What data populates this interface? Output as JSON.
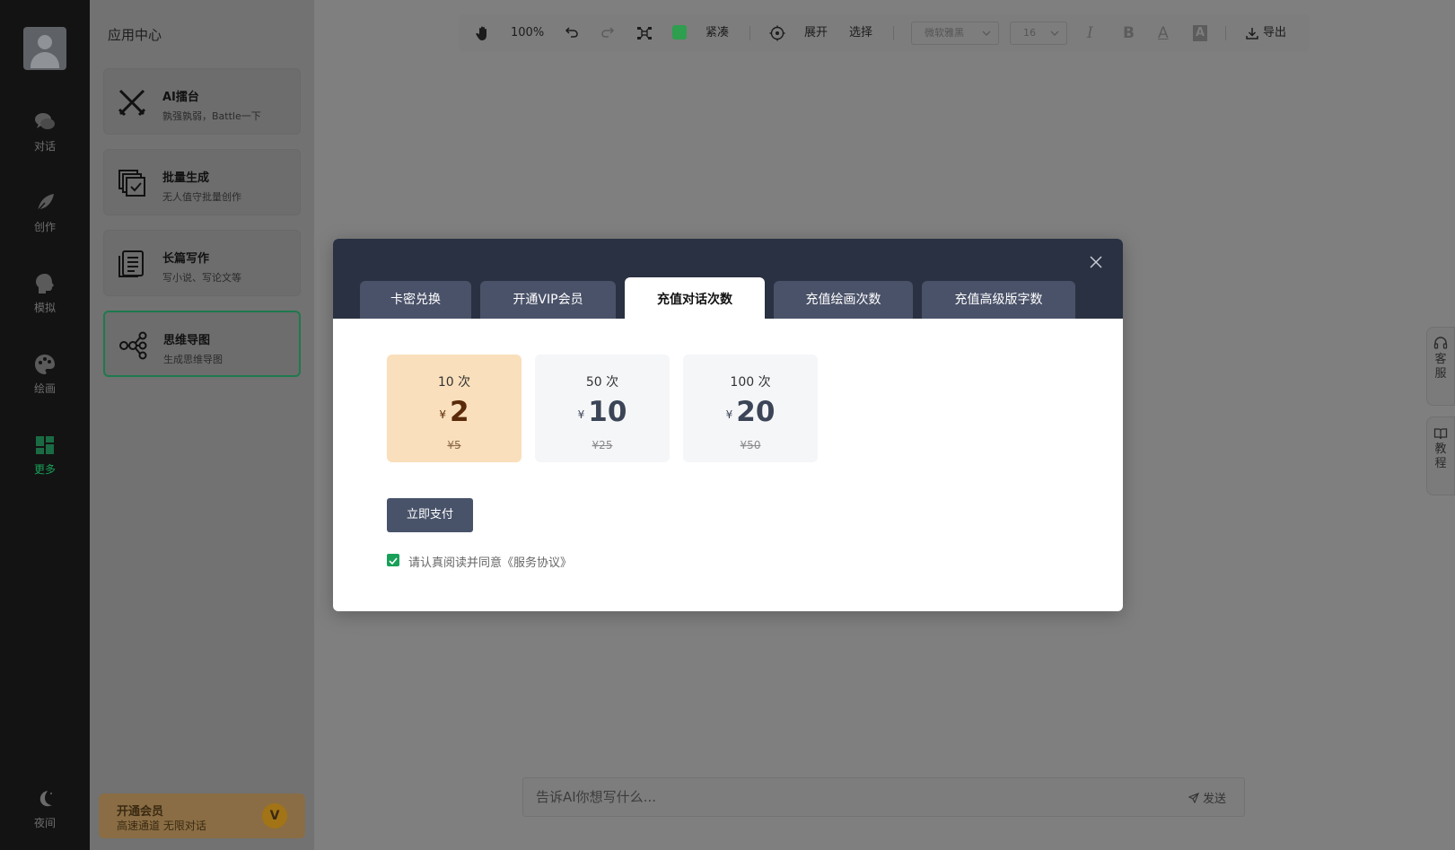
{
  "nav": {
    "items": [
      {
        "label": "对话",
        "icon": "chat-icon"
      },
      {
        "label": "创作",
        "icon": "feather-icon"
      },
      {
        "label": "模拟",
        "icon": "head-icon"
      },
      {
        "label": "绘画",
        "icon": "palette-icon"
      },
      {
        "label": "更多",
        "icon": "grid-icon",
        "active": true
      }
    ],
    "night_label": "夜间"
  },
  "apps": {
    "title": "应用中心",
    "cards": [
      {
        "name": "AI擂台",
        "desc": "孰强孰弱，Battle一下",
        "icon": "swords-icon"
      },
      {
        "name": "批量生成",
        "desc": "无人值守批量创作",
        "icon": "batch-icon"
      },
      {
        "name": "长篇写作",
        "desc": "写小说、写论文等",
        "icon": "document-icon"
      },
      {
        "name": "思维导图",
        "desc": "生成思维导图",
        "icon": "mindmap-icon",
        "active": true
      }
    ],
    "vip": {
      "title": "开通会员",
      "subtitle": "高速通道 无限对话",
      "badge": "V"
    }
  },
  "toolbar": {
    "zoom": "100%",
    "layout_label": "紧凑",
    "expand_label": "展开",
    "select_label": "选择",
    "font_family": "微软雅黑",
    "font_size": "16",
    "italic": "I",
    "bold": "B",
    "font_color": "A",
    "bg_color": "A",
    "export_label": "导出",
    "accent_color": "#2e9e4f"
  },
  "side": {
    "service": "客服",
    "tutorial": "教程"
  },
  "prompt": {
    "placeholder": "告诉AI你想写什么...",
    "send_label": "发送"
  },
  "modal": {
    "tabs": [
      "卡密兑换",
      "开通VIP会员",
      "充值对话次数",
      "充值绘画次数",
      "充值高级版字数"
    ],
    "active_tab": 2,
    "currency": "¥",
    "packages": [
      {
        "count": "10 次",
        "price": "2",
        "original": "¥5",
        "selected": true
      },
      {
        "count": "50 次",
        "price": "10",
        "original": "¥25"
      },
      {
        "count": "100 次",
        "price": "20",
        "original": "¥50"
      }
    ],
    "pay_label": "立即支付",
    "agree_text": "请认真阅读并同意《服务协议》"
  }
}
